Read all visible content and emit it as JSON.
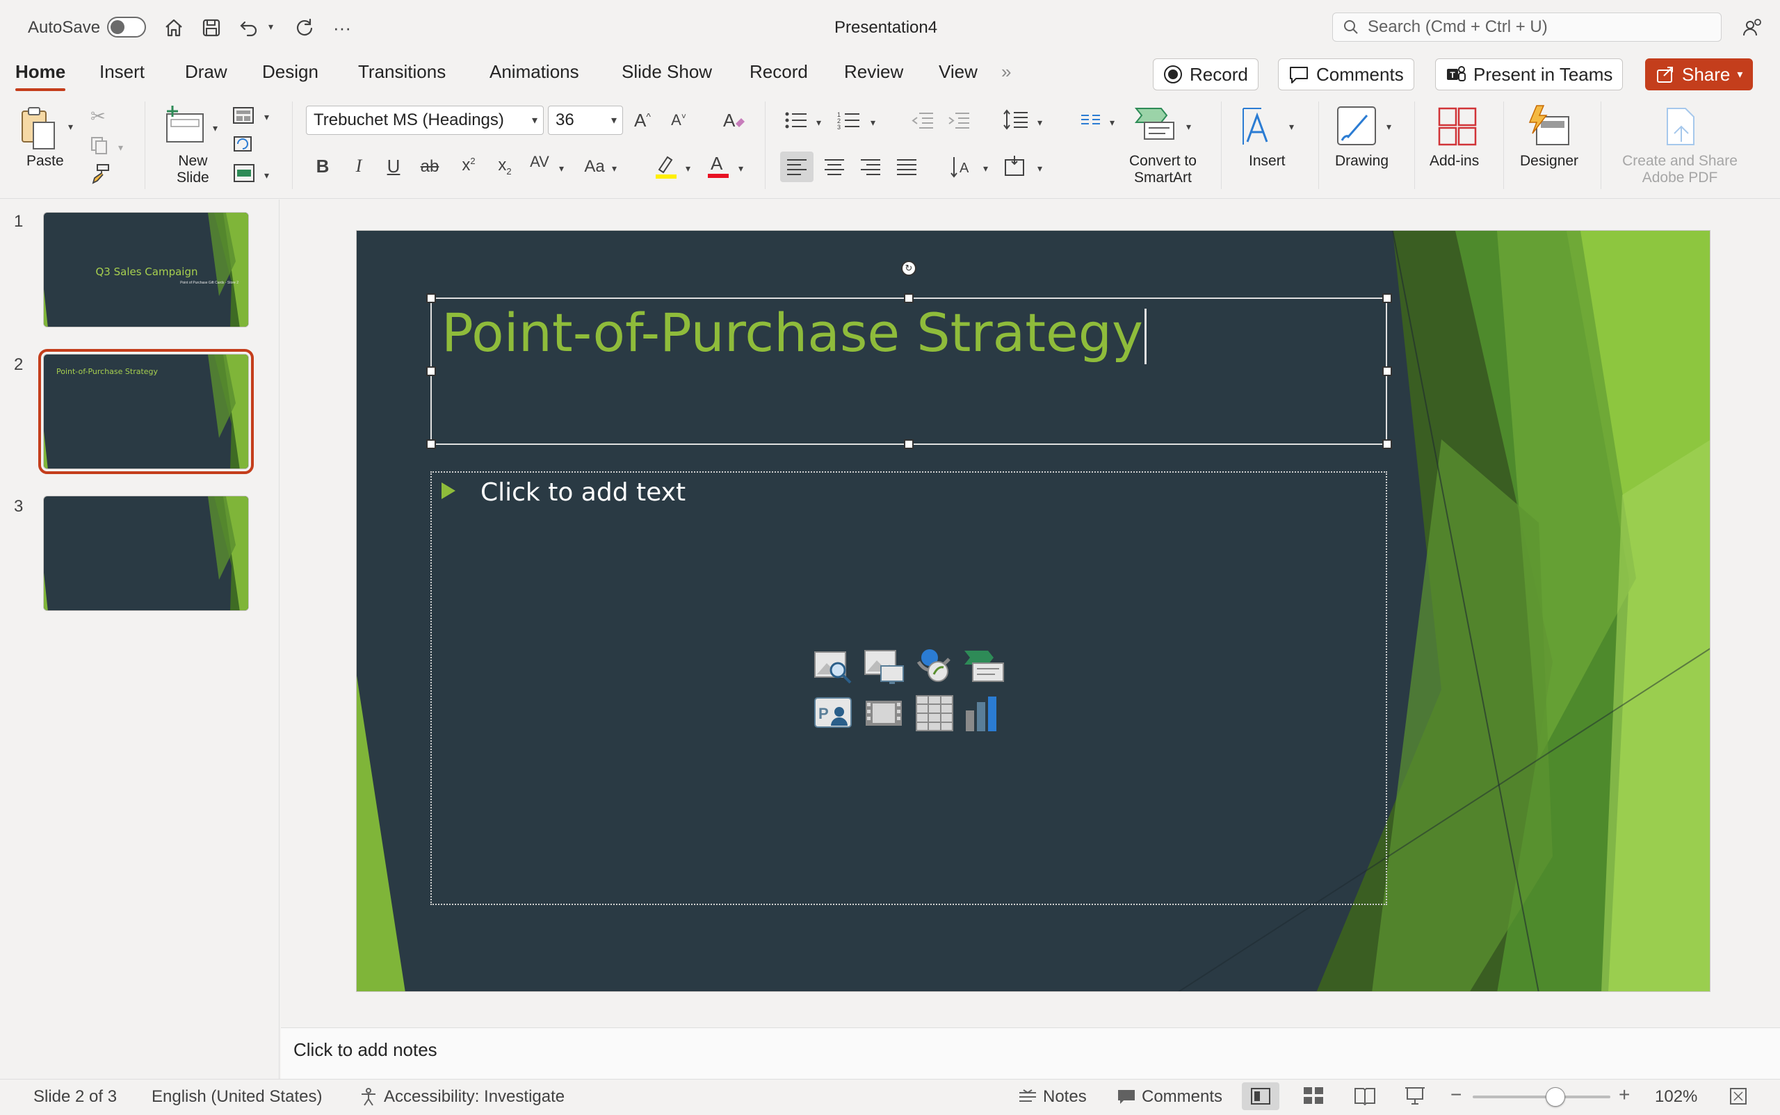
{
  "titlebar": {
    "autosave_label": "AutoSave",
    "autosave_state": "off",
    "document_title": "Presentation4",
    "search_placeholder": "Search (Cmd + Ctrl + U)"
  },
  "tabs": [
    "Home",
    "Insert",
    "Draw",
    "Design",
    "Transitions",
    "Animations",
    "Slide Show",
    "Record",
    "Review",
    "View"
  ],
  "active_tab": "Home",
  "top_buttons": {
    "record": "Record",
    "comments": "Comments",
    "present_in_teams": "Present in Teams",
    "share": "Share"
  },
  "ribbon": {
    "paste": "Paste",
    "new_slide_line1": "New",
    "new_slide_line2": "Slide",
    "font_name": "Trebuchet MS (Headings)",
    "font_size": "36",
    "convert_smartart_line1": "Convert to",
    "convert_smartart_line2": "SmartArt",
    "insert": "Insert",
    "drawing": "Drawing",
    "addins": "Add-ins",
    "designer": "Designer",
    "adobe_line1": "Create and Share",
    "adobe_line2": "Adobe PDF"
  },
  "thumbnails": [
    {
      "num": "1",
      "title": "Q3 Sales Campaign",
      "subtitle": "Point of Purchase Gift Cards - Store 2"
    },
    {
      "num": "2",
      "title": "Point-of-Purchase Strategy",
      "subtitle": ""
    },
    {
      "num": "3",
      "title": "",
      "subtitle": ""
    }
  ],
  "selected_slide": 2,
  "slide": {
    "title": "Point-of-Purchase Strategy",
    "content_placeholder": "Click to add text"
  },
  "notes_placeholder": "Click to add notes",
  "statusbar": {
    "slide_info": "Slide 2 of 3",
    "language": "English (United States)",
    "accessibility": "Accessibility: Investigate",
    "notes": "Notes",
    "comments": "Comments",
    "zoom": "102%",
    "zoom_fraction": 0.6
  },
  "colors": {
    "accent": "#c43e1c",
    "slide_bg": "#2a3a44",
    "title_green": "#8fbc3b"
  }
}
